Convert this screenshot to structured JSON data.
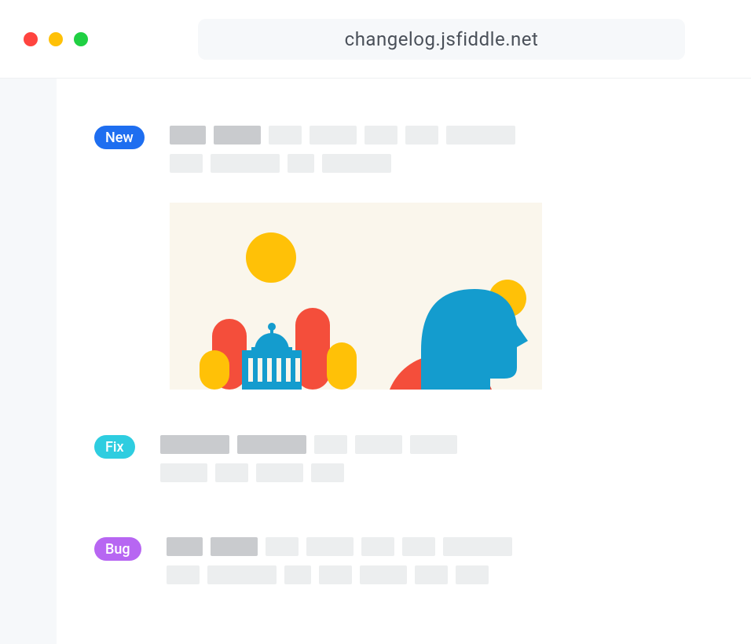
{
  "browser": {
    "url": "changelog.jsfiddle.net"
  },
  "entries": [
    {
      "badge": {
        "label": "New",
        "variant": "new"
      },
      "lines": [
        [
          {
            "w": 46,
            "tone": "dark"
          },
          {
            "w": 60,
            "tone": "dark"
          },
          {
            "w": 42,
            "tone": "light"
          },
          {
            "w": 60,
            "tone": "light"
          },
          {
            "w": 42,
            "tone": "light"
          },
          {
            "w": 42,
            "tone": "light"
          },
          {
            "w": 88,
            "tone": "light"
          }
        ],
        [
          {
            "w": 42,
            "tone": "light"
          },
          {
            "w": 88,
            "tone": "light"
          },
          {
            "w": 34,
            "tone": "light"
          },
          {
            "w": 88,
            "tone": "light"
          }
        ]
      ],
      "has_illustration": true
    },
    {
      "badge": {
        "label": "Fix",
        "variant": "fix"
      },
      "lines": [
        [
          {
            "w": 88,
            "tone": "dark"
          },
          {
            "w": 88,
            "tone": "dark"
          },
          {
            "w": 42,
            "tone": "light"
          },
          {
            "w": 60,
            "tone": "light"
          },
          {
            "w": 60,
            "tone": "light"
          }
        ],
        [
          {
            "w": 60,
            "tone": "light"
          },
          {
            "w": 42,
            "tone": "light"
          },
          {
            "w": 60,
            "tone": "light"
          },
          {
            "w": 42,
            "tone": "light"
          }
        ]
      ],
      "has_illustration": false
    },
    {
      "badge": {
        "label": "Bug",
        "variant": "bug"
      },
      "lines": [
        [
          {
            "w": 46,
            "tone": "dark"
          },
          {
            "w": 60,
            "tone": "dark"
          },
          {
            "w": 42,
            "tone": "light"
          },
          {
            "w": 60,
            "tone": "light"
          },
          {
            "w": 42,
            "tone": "light"
          },
          {
            "w": 42,
            "tone": "light"
          },
          {
            "w": 88,
            "tone": "light"
          }
        ],
        [
          {
            "w": 42,
            "tone": "light"
          },
          {
            "w": 88,
            "tone": "light"
          },
          {
            "w": 34,
            "tone": "light"
          },
          {
            "w": 42,
            "tone": "light"
          },
          {
            "w": 60,
            "tone": "light"
          },
          {
            "w": 42,
            "tone": "light"
          },
          {
            "w": 42,
            "tone": "light"
          }
        ]
      ],
      "has_illustration": false
    }
  ],
  "colors": {
    "new": "#1e6ef0",
    "fix": "#2ecde0",
    "bug": "#b766f2"
  }
}
